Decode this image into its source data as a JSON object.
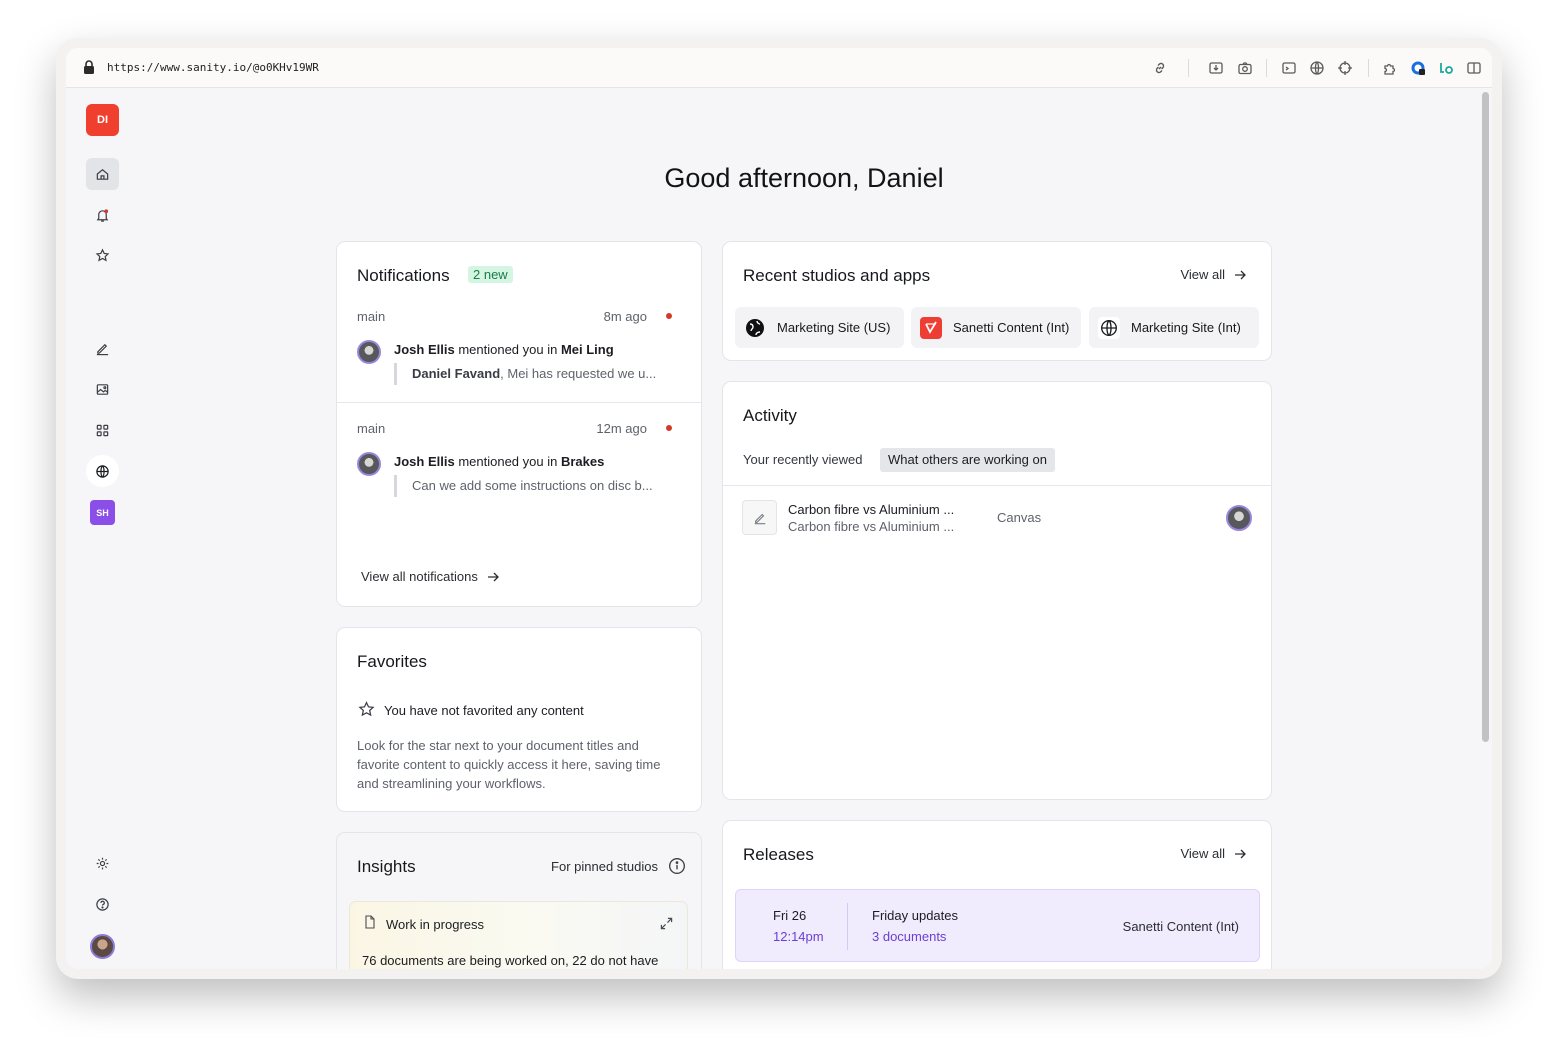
{
  "browser": {
    "url": "https://www.sanity.io/@o0KHv19WR"
  },
  "sidebar": {
    "workspace_initials": "DI",
    "sh_initials": "SH",
    "items": [
      "home-icon",
      "bell-icon",
      "star-icon",
      "edit-icon",
      "media-icon",
      "grid-icon",
      "globe-icon",
      "sh-app",
      "gear-icon",
      "help-icon",
      "user-avatar"
    ]
  },
  "greeting": "Good afternoon, Daniel",
  "notifications": {
    "title": "Notifications",
    "badge": "2 new",
    "items": [
      {
        "branch": "main",
        "time": "8m ago",
        "actor": "Josh Ellis",
        "action": " mentioned you in ",
        "target": "Mei Ling",
        "quote_author": "Daniel Favand",
        "quote_text": ", Mei has requested we u..."
      },
      {
        "branch": "main",
        "time": "12m ago",
        "actor": "Josh Ellis",
        "action": " mentioned you in ",
        "target": "Brakes",
        "quote_author": "",
        "quote_text": "Can we add some instructions on disc b..."
      }
    ],
    "view_all": "View all notifications"
  },
  "favorites": {
    "title": "Favorites",
    "empty": "You have not favorited any content",
    "help_lines": [
      "Look for the star next to your document titles and",
      "favorite content to quickly access it here, saving time",
      "and streamlining your workflows."
    ]
  },
  "insights": {
    "title": "Insights",
    "filter": "For pinned studios",
    "box_title": "Work in progress",
    "box_text": "76 documents are being worked on, 22 do not have"
  },
  "recent": {
    "title": "Recent studios and apps",
    "view_all": "View all",
    "studios": [
      "Marketing Site (US)",
      "Sanetti Content (Int)",
      "Marketing Site (Int)"
    ]
  },
  "activity": {
    "title": "Activity",
    "tabs": [
      "Your recently viewed",
      "What others are working on"
    ],
    "rows": [
      {
        "title": "Carbon fibre vs Aluminium ...",
        "subtitle": "Carbon fibre vs Aluminium ...",
        "type": "Canvas"
      }
    ]
  },
  "releases": {
    "title": "Releases",
    "view_all": "View all",
    "items": [
      {
        "date": "Fri 26",
        "time": "12:14pm",
        "name": "Friday updates",
        "docs": "3 documents",
        "studio": "Sanetti Content (Int)"
      }
    ]
  },
  "colors": {
    "accent_red": "#f03e2f",
    "purple": "#8b4ee8",
    "release_purple": "#6a3fd1",
    "new_badge": "#d5f5e3"
  }
}
